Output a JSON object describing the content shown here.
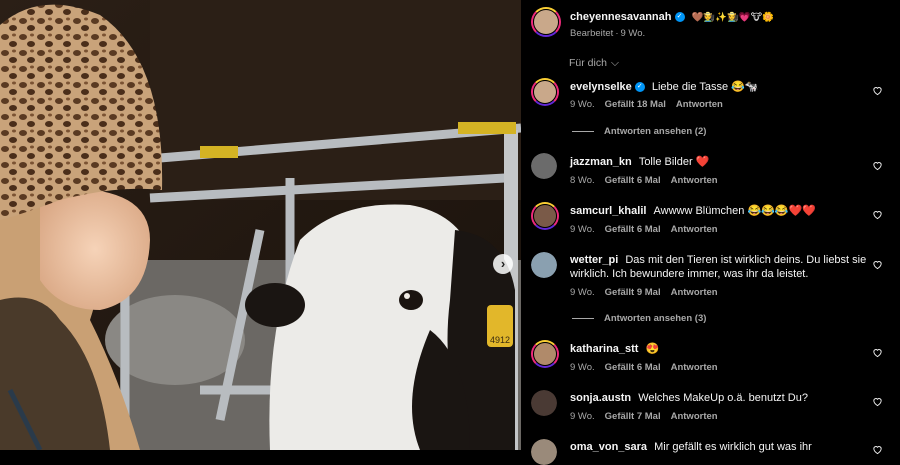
{
  "post": {
    "author": "cheyennesavannah",
    "caption_emojis": "🤎🧑‍🌾✨👩‍🌾💗🐮🌼",
    "edited": "Bearbeitet",
    "age": "9 Wo.",
    "sort_label": "Für dich"
  },
  "comments": [
    {
      "user": "evelynselke",
      "verified": true,
      "text": "Liebe die Tasse 😂🐄",
      "age": "9 Wo.",
      "likes": "Gefällt 18 Mal",
      "reply": "Antworten",
      "view_replies": "Antworten ansehen (2)",
      "avatar_color": "#c9a88a"
    },
    {
      "user": "jazzman_kn",
      "verified": false,
      "text": "Tolle Bilder ❤️",
      "age": "8 Wo.",
      "likes": "Gefällt 6 Mal",
      "reply": "Antworten",
      "avatar_color": "#6b6b6b"
    },
    {
      "user": "samcurl_khalil",
      "verified": false,
      "text": "Awwww Blümchen 😂😂😂❤️❤️",
      "age": "9 Wo.",
      "likes": "Gefällt 6 Mal",
      "reply": "Antworten",
      "avatar_color": "#7a5a48"
    },
    {
      "user": "wetter_pi",
      "verified": false,
      "text": "Das mit den Tieren ist wirklich deins. Du liebst sie wirklich. Ich bewundere immer, was ihr da leistet.",
      "age": "9 Wo.",
      "likes": "Gefällt 9 Mal",
      "reply": "Antworten",
      "view_replies": "Antworten ansehen (3)",
      "avatar_color": "#8aa0b0"
    },
    {
      "user": "katharina_stt",
      "verified": false,
      "text": "😍",
      "age": "9 Wo.",
      "likes": "Gefällt 6 Mal",
      "reply": "Antworten",
      "avatar_color": "#b08a6a"
    },
    {
      "user": "sonja.austn",
      "verified": false,
      "text": "Welches MakeUp o.ä. benutzt Du?",
      "age": "9 Wo.",
      "likes": "Gefällt 7 Mal",
      "reply": "Antworten",
      "avatar_color": "#4a3a34"
    },
    {
      "user": "oma_von_sara",
      "verified": false,
      "text": "Mir gefällt es wirklich gut was ihr",
      "avatar_color": "#9a8a7a"
    }
  ],
  "image": {
    "ear_tag_text": "4912"
  },
  "colors": {
    "verified": "#0095f6",
    "heart_red": "#ed4956"
  }
}
